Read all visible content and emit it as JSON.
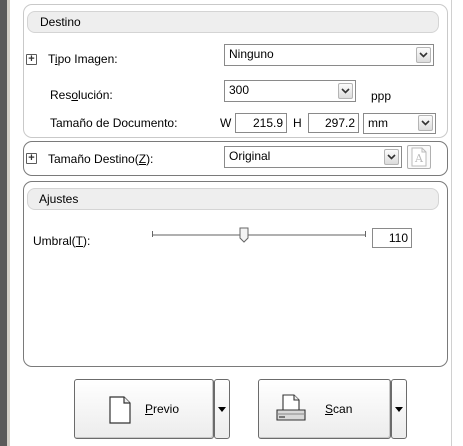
{
  "destino": {
    "title": "Destino",
    "tipo_imagen": {
      "label_pre": "T",
      "label_u": "i",
      "label_post": "po Imagen:",
      "value": "Ninguno"
    },
    "resolucion": {
      "label_pre": "Res",
      "label_u": "o",
      "label_post": "lución:",
      "value": "300",
      "unit": "ppp"
    },
    "tamano_documento": {
      "label": "Tamaño de Documento:",
      "w_label": "W",
      "w_value": "215.9",
      "h_label": "H",
      "h_value": "297.2",
      "unit": "mm"
    },
    "tamano_destino": {
      "label_pre": "Tamaño Destino(",
      "label_u": "Z",
      "label_post": "):",
      "value": "Original"
    }
  },
  "ajustes": {
    "title": "Ajustes",
    "umbral": {
      "label_pre": "Umbral(",
      "label_u": "T",
      "label_post": "):",
      "value": "110",
      "fraction": 0.43
    }
  },
  "buttons": {
    "previo": {
      "label_u": "P",
      "label_rest": "revio"
    },
    "scan": {
      "label_u": "S",
      "label_rest": "can"
    }
  },
  "icons": {
    "plus": "plus-box-icon",
    "dropdown": "chevron-down-icon",
    "document": "page-icon",
    "scanner": "scanner-icon"
  }
}
